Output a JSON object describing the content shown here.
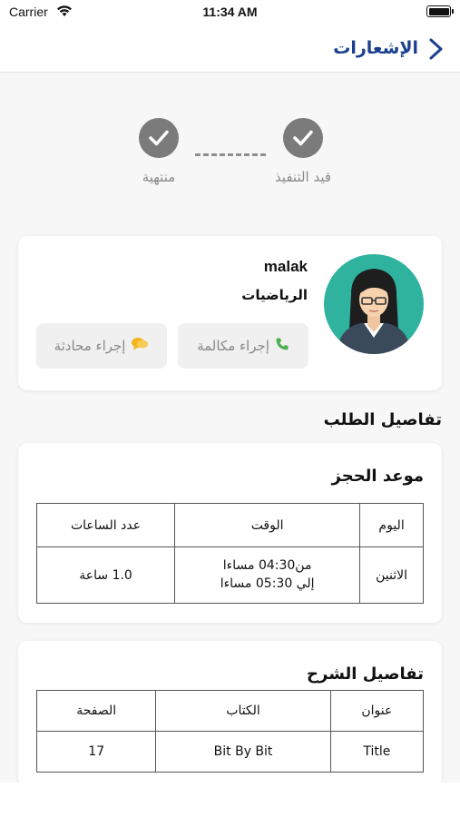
{
  "status_bar": {
    "carrier": "Carrier",
    "time": "11:34 AM"
  },
  "nav": {
    "title": "الإشعارات",
    "back_icon": "chevron-left-icon"
  },
  "stepper": {
    "steps": [
      {
        "label": "قيد التنفيذ",
        "done": true
      },
      {
        "label": "منتهية",
        "done": true
      }
    ]
  },
  "profile": {
    "name": "malak",
    "subject": "الرياضيات",
    "call_label": "إجراء مكالمة",
    "chat_label": "إجراء محادثة"
  },
  "order_details": {
    "title": "تفاصيل الطلب",
    "booking": {
      "title": "موعد الحجز",
      "headers": [
        "اليوم",
        "الوقت",
        "عدد الساعات"
      ],
      "row": {
        "day": "الاثنين",
        "time_from": "من04:30 مساءا",
        "time_to": "إلي 05:30 مساءا",
        "hours": "1.0 ساعة"
      }
    },
    "explanation": {
      "title": "تفاصيل الشرح",
      "headers": [
        "عنوان",
        "الكتاب",
        "الصفحة"
      ],
      "row": [
        "Title",
        "Bit By Bit",
        "17"
      ]
    }
  },
  "colors": {
    "accent": "#1b3f8f",
    "step_done": "#7b7b7b",
    "avatar_bg": "#2fb39f",
    "call_icon": "#4caf50",
    "chat_icon": "#f2b51d"
  }
}
